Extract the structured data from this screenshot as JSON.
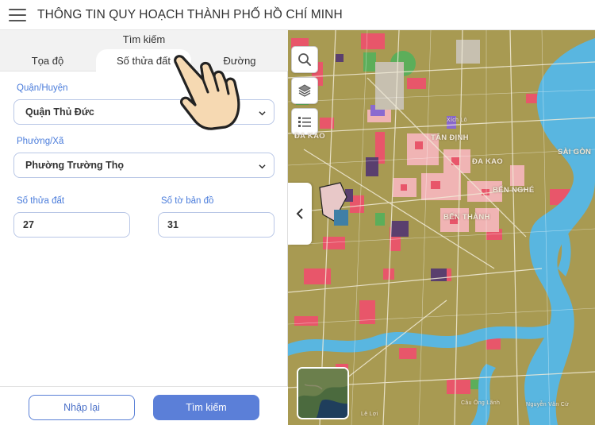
{
  "header": {
    "title": "THÔNG TIN QUY HOẠCH THÀNH PHỐ HỒ CHÍ MINH"
  },
  "panel": {
    "heading": "Tìm kiếm",
    "tabs": [
      {
        "label": "Tọa độ",
        "active": false
      },
      {
        "label": "Số thửa đất",
        "active": true
      },
      {
        "label": "Đường",
        "active": false
      }
    ],
    "district": {
      "label": "Quận/Huyện",
      "value": "Quận Thủ Đức"
    },
    "ward": {
      "label": "Phường/Xã",
      "value": "Phường Trường Thọ"
    },
    "parcel": {
      "label": "Số thửa đất",
      "value": "27"
    },
    "sheet": {
      "label": "Số tờ bản đồ",
      "value": "31"
    },
    "buttons": {
      "reset": "Nhập lại",
      "search": "Tìm kiếm"
    }
  },
  "map": {
    "controls": [
      "search-icon",
      "layers-icon",
      "list-icon",
      "chevron-left-icon"
    ],
    "labels": [
      {
        "text": "TÂN ĐỊNH"
      },
      {
        "text": "ĐA KAO"
      },
      {
        "text": "BẾN NGHÉ"
      },
      {
        "text": "BẾN THÀNH"
      },
      {
        "text": "SÀI GÒN"
      },
      {
        "text": "ĐA KAO"
      }
    ],
    "street_labels": [
      "Xích Lô",
      "Cầu Ông Lãnh",
      "Nguyễn Văn Cừ",
      "Lê Lợi"
    ],
    "colors": {
      "residential": "#a89a52",
      "commercial": "#e8566a",
      "mixed": "#f0b4b4",
      "water": "#59b6e0",
      "park": "#5cae5a",
      "public": "#5a3f6e"
    }
  }
}
